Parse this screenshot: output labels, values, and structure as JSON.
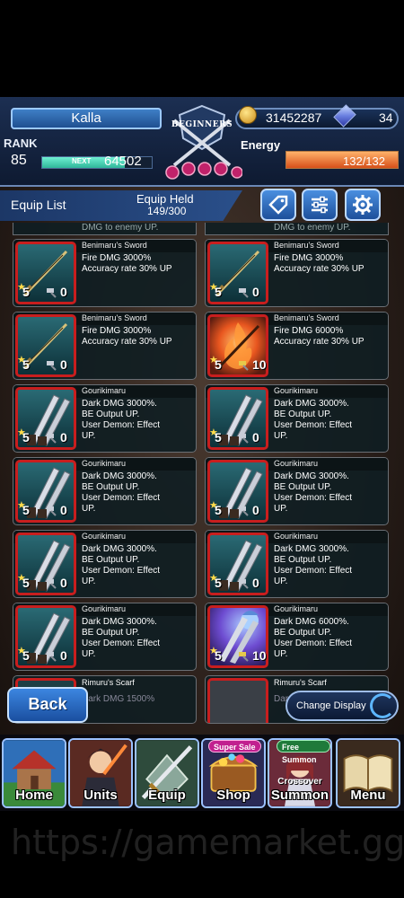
{
  "header": {
    "player_name": "Kalla",
    "rank_label": "RANK",
    "rank": "85",
    "next_label": "NEXT",
    "next_exp": "64502",
    "exp_progress": 0.75,
    "emblem_label": "BEGINNERS",
    "coins": "31452287",
    "gems": "34",
    "energy_label": "Energy",
    "energy": "132/132",
    "energy_progress": 1.0
  },
  "equip_bar": {
    "title": "Equip List",
    "held_label": "Equip Held",
    "held_value": "149/300",
    "buttons": [
      "tag-icon",
      "filter-icon",
      "gear-icon"
    ]
  },
  "cut_top": {
    "left": "DMG to enemy UP.",
    "right": "DMG to enemy UP."
  },
  "cards": [
    {
      "name": "Benimaru's Sword",
      "desc": [
        "Fire DMG 3000%",
        "Accuracy rate 30% UP"
      ],
      "level": "5",
      "count": "0",
      "art": "sword"
    },
    {
      "name": "Benimaru's Sword",
      "desc": [
        "Fire DMG 3000%",
        "Accuracy rate 30% UP"
      ],
      "level": "5",
      "count": "0",
      "art": "sword"
    },
    {
      "name": "Benimaru's Sword",
      "desc": [
        "Fire DMG 3000%",
        "Accuracy rate 30% UP"
      ],
      "level": "5",
      "count": "0",
      "art": "sword"
    },
    {
      "name": "Benimaru's Sword",
      "desc": [
        "Fire DMG 6000%",
        "Accuracy rate 30% UP"
      ],
      "level": "5",
      "count": "10",
      "art": "fire"
    },
    {
      "name": "Gourikimaru",
      "desc": [
        "Dark DMG 3000%.",
        "BE Output UP.",
        "User Demon: Effect",
        "UP."
      ],
      "level": "5",
      "count": "0",
      "art": "blades"
    },
    {
      "name": "Gourikimaru",
      "desc": [
        "Dark DMG 3000%.",
        "BE Output UP.",
        "User Demon: Effect",
        "UP."
      ],
      "level": "5",
      "count": "0",
      "art": "blades"
    },
    {
      "name": "Gourikimaru",
      "desc": [
        "Dark DMG 3000%.",
        "BE Output UP.",
        "User Demon: Effect",
        "UP."
      ],
      "level": "5",
      "count": "0",
      "art": "blades"
    },
    {
      "name": "Gourikimaru",
      "desc": [
        "Dark DMG 3000%.",
        "BE Output UP.",
        "User Demon: Effect",
        "UP."
      ],
      "level": "5",
      "count": "0",
      "art": "blades"
    },
    {
      "name": "Gourikimaru",
      "desc": [
        "Dark DMG 3000%.",
        "BE Output UP.",
        "User Demon: Effect",
        "UP."
      ],
      "level": "5",
      "count": "0",
      "art": "blades"
    },
    {
      "name": "Gourikimaru",
      "desc": [
        "Dark DMG 3000%.",
        "BE Output UP.",
        "User Demon: Effect",
        "UP."
      ],
      "level": "5",
      "count": "0",
      "art": "blades"
    },
    {
      "name": "Gourikimaru",
      "desc": [
        "Dark DMG 3000%.",
        "BE Output UP.",
        "User Demon: Effect",
        "UP."
      ],
      "level": "5",
      "count": "0",
      "art": "blades"
    },
    {
      "name": "Gourikimaru",
      "desc": [
        "Dark DMG 6000%.",
        "BE Output UP.",
        "User Demon: Effect",
        "UP."
      ],
      "level": "5",
      "count": "10",
      "art": "demon"
    }
  ],
  "partial_cards": [
    {
      "name": "Rimuru's Scarf",
      "desc": "Dark DMG 1500%"
    },
    {
      "name": "Rimuru's Scarf",
      "desc": "Dar"
    }
  ],
  "back_label": "Back",
  "change_display_label": "Change Display",
  "nav": [
    {
      "label": "Home",
      "tag": ""
    },
    {
      "label": "Units",
      "tag": ""
    },
    {
      "label": "Equip",
      "tag": ""
    },
    {
      "label": "Shop",
      "tag": "Super Sale"
    },
    {
      "label": "Summon",
      "tag": "Free Summon",
      "sub": "Crossover"
    },
    {
      "label": "Menu",
      "tag": ""
    }
  ],
  "watermark": "https://gamemarket.gg/s",
  "colors": {
    "frame_red": "#c81e1e",
    "accent_blue": "#3c86e0",
    "energy_orange": "#d6501a",
    "exp_green": "#2fb69a"
  }
}
